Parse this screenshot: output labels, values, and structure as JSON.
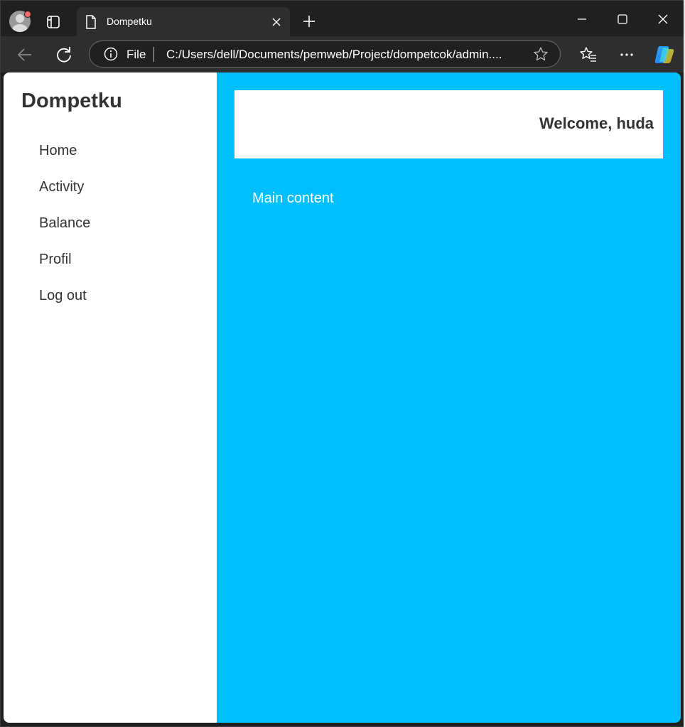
{
  "browser": {
    "tab_title": "Dompetku",
    "address_scheme_label": "File",
    "address_url": "C:/Users/dell/Documents/pemweb/Project/dompetcok/admin....",
    "icons": [
      "profile-avatar-icon",
      "tab-actions-icon",
      "page-icon",
      "close-icon",
      "new-tab-icon",
      "minimize-icon",
      "maximize-icon",
      "window-close-icon",
      "back-icon",
      "reload-icon",
      "info-icon",
      "favorite-star-icon",
      "favorites-icon",
      "more-options-icon",
      "copilot-icon"
    ]
  },
  "sidebar": {
    "brand": "Dompetku",
    "items": [
      {
        "label": "Home"
      },
      {
        "label": "Activity"
      },
      {
        "label": "Balance"
      },
      {
        "label": "Profil"
      },
      {
        "label": "Log out"
      }
    ]
  },
  "header": {
    "welcome": "Welcome, huda"
  },
  "main": {
    "text": "Main content"
  },
  "colors": {
    "main_background": "#00bfff",
    "sidebar_background": "#ffffff",
    "text_dark": "#333333",
    "browser_chrome": "#202020"
  }
}
